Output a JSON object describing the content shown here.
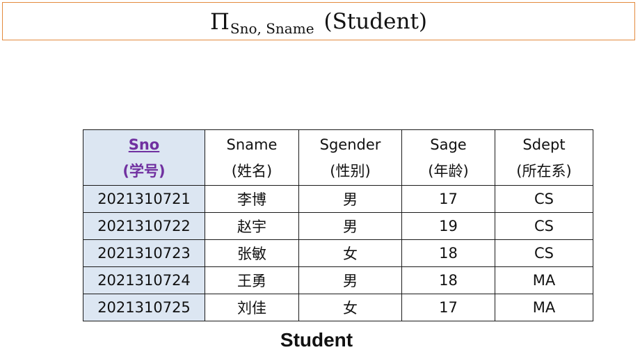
{
  "formula": {
    "symbol": "Π",
    "subscript": "Sno, Sname",
    "argument": "(Student)"
  },
  "table": {
    "columns": [
      {
        "name": "Sno",
        "note": "(学号)",
        "key": true
      },
      {
        "name": "Sname",
        "note": "(姓名)",
        "key": false
      },
      {
        "name": "Sgender",
        "note": "(性别)",
        "key": false
      },
      {
        "name": "Sage",
        "note": "(年龄)",
        "key": false
      },
      {
        "name": "Sdept",
        "note": "(所在系)",
        "key": false
      }
    ],
    "rows": [
      [
        "2021310721",
        "李博",
        "男",
        "17",
        "CS"
      ],
      [
        "2021310722",
        "赵宇",
        "男",
        "19",
        "CS"
      ],
      [
        "2021310723",
        "张敏",
        "女",
        "18",
        "CS"
      ],
      [
        "2021310724",
        "王勇",
        "男",
        "18",
        "MA"
      ],
      [
        "2021310725",
        "刘佳",
        "女",
        "17",
        "MA"
      ]
    ]
  },
  "caption": "Student",
  "colors": {
    "formula_border": "#e38a3d",
    "key_column_fill": "#dce6f2",
    "key_header_text": "#7030a0"
  }
}
